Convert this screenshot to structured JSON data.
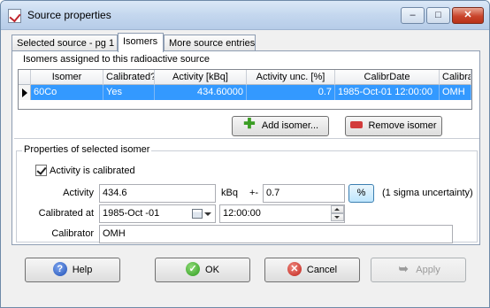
{
  "window": {
    "title": "Source properties",
    "controls": {
      "minimize": "–",
      "maximize": "□",
      "close": "✕"
    }
  },
  "tabs": [
    {
      "label": "Selected source - pg 1",
      "active": false
    },
    {
      "label": "Isomers",
      "active": true
    },
    {
      "label": "More source entries",
      "active": false
    }
  ],
  "isomers_group": {
    "title": "Isomers assigned to this radioactive source",
    "columns": [
      "Isomer",
      "Calibrated?",
      "Activity [kBq]",
      "Activity unc. [%]",
      "CalibrDate",
      "Calibrator"
    ],
    "rows": [
      {
        "isomer": "60Co",
        "calibrated": "Yes",
        "activity": "434.60000",
        "unc": "0.7",
        "calibr_date": "1985-Oct-01 12:00:00",
        "calibrator": "OMH"
      }
    ],
    "add_button": "Add isomer...",
    "remove_button": "Remove isomer"
  },
  "properties_group": {
    "title": "Properties of selected isomer",
    "calibrated_checkbox": {
      "label": "Activity is calibrated",
      "checked": true
    },
    "activity_label": "Activity",
    "activity_value": "434.6",
    "activity_unit": "kBq",
    "plusminus": "+-",
    "uncertainty_value": "0.7",
    "percent_button": "%",
    "uncertainty_note": "(1 sigma uncertainty)",
    "calibrated_at_label": "Calibrated at",
    "date_value": "1985-Oct -01",
    "time_value": "12:00:00",
    "calibrator_label": "Calibrator",
    "calibrator_value": "OMH"
  },
  "footer": {
    "help": "Help",
    "ok": "OK",
    "cancel": "Cancel",
    "apply": "Apply",
    "apply_enabled": false
  }
}
